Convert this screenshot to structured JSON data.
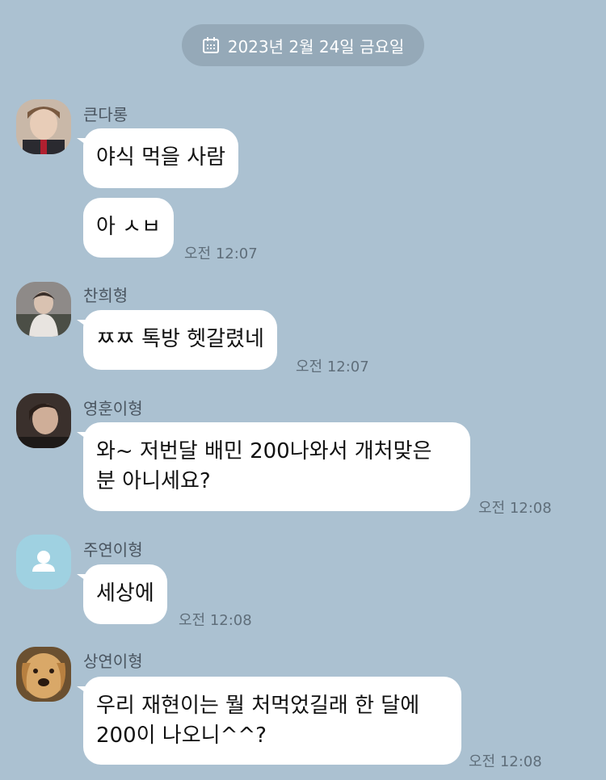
{
  "date_divider": {
    "label": "2023년 2월 24일 금요일"
  },
  "messages": [
    {
      "sender": "큰다롱",
      "bubbles": [
        "야식 먹을 사람",
        "아 ㅅㅂ"
      ],
      "time": "오전 12:07"
    },
    {
      "sender": "찬희형",
      "bubbles": [
        "ㅉㅉ 톡방 헷갈렸네"
      ],
      "time": "오전 12:07"
    },
    {
      "sender": "영훈이형",
      "bubbles": [
        "와~ 저번달 배민 200나와서 개처맞은\n분 아니세요?"
      ],
      "time": "오전 12:08"
    },
    {
      "sender": "주연이형",
      "bubbles": [
        "세상에"
      ],
      "time": "오전 12:08"
    },
    {
      "sender": "상연이형",
      "bubbles": [
        "우리 재현이는 뭘 처먹었길래 한 달에\n200이 나오니^^?"
      ],
      "time": "오전 12:08"
    }
  ]
}
